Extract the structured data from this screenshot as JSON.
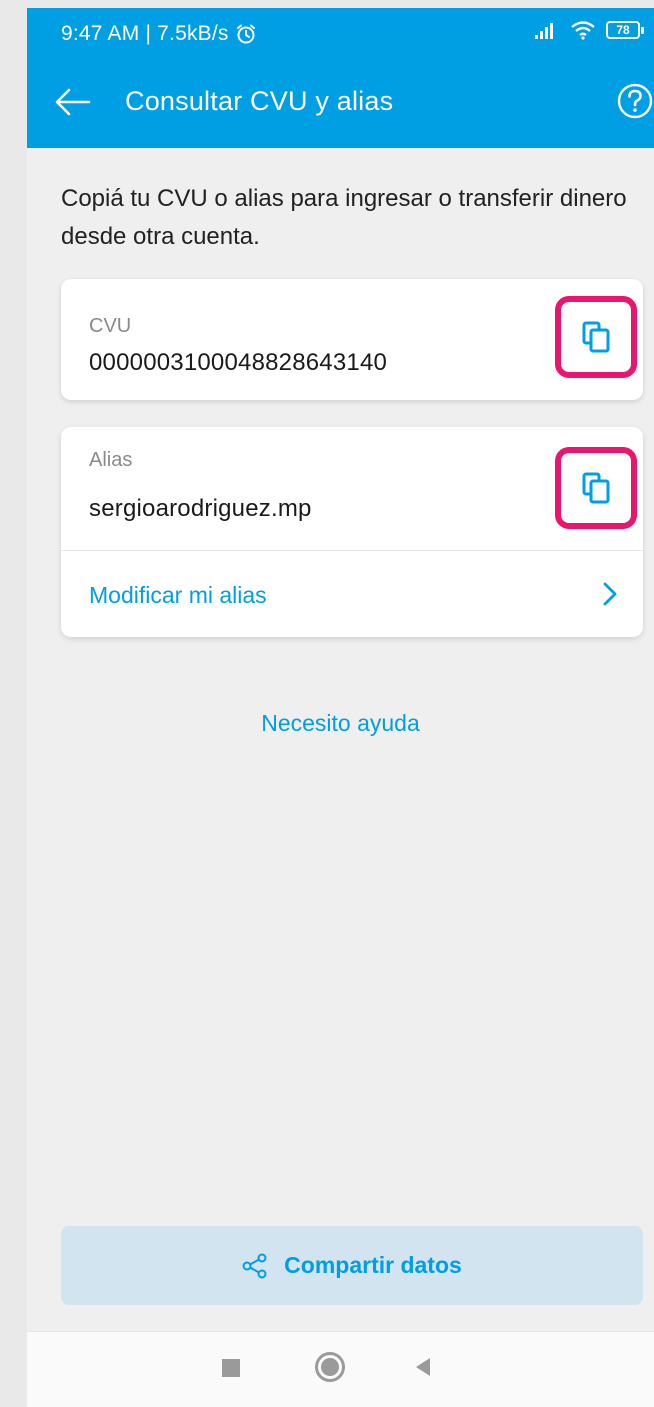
{
  "status_bar": {
    "time_speed": "9:47 AM | 7.5kB/s",
    "battery": "78",
    "icons": [
      "alarm-icon",
      "signal-icon",
      "wifi-icon",
      "battery-icon"
    ]
  },
  "header": {
    "title": "Consultar CVU y alias",
    "back_icon": "arrow-left-icon",
    "help_icon": "help-circle-icon"
  },
  "intro_text": "Copiá tu CVU o alias para ingresar o transferir dinero desde otra cuenta.",
  "cvu_card": {
    "label": "CVU",
    "value": "0000003100048828643140",
    "copy_icon": "copy-icon"
  },
  "alias_card": {
    "label": "Alias",
    "value": "sergioarodriguez.mp",
    "copy_icon": "copy-icon",
    "modify_link": "Modificar mi alias",
    "chevron_icon": "chevron-right-icon"
  },
  "help_link": "Necesito ayuda",
  "share_button": {
    "label": "Compartir datos",
    "icon": "share-icon"
  },
  "nav_bar": {
    "icons": [
      "recents-square-icon",
      "home-circle-icon",
      "back-triangle-icon"
    ]
  },
  "colors": {
    "brand_blue": "#009ee3",
    "highlight_pink": "#e8166f",
    "share_bg": "#d1e4ef",
    "page_bg": "#efefef"
  }
}
